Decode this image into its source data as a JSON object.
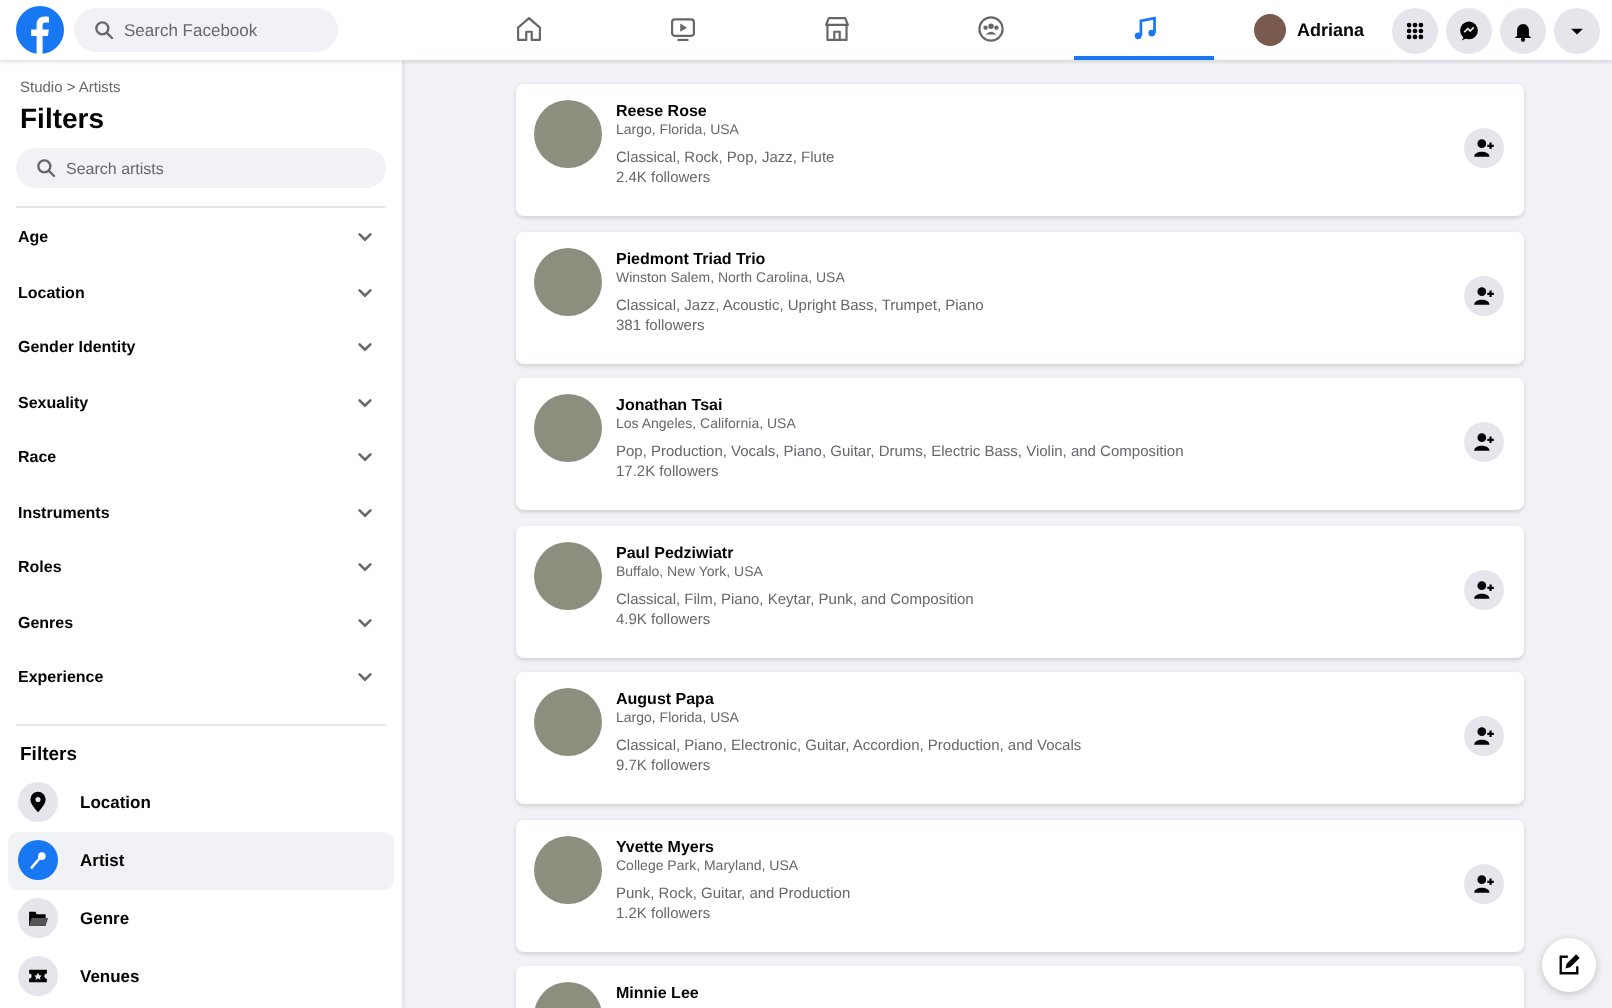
{
  "topbar": {
    "search": {
      "placeholder": "Search Facebook"
    },
    "nav": [
      {
        "kind": "home",
        "selected": false
      },
      {
        "kind": "video",
        "selected": false
      },
      {
        "kind": "store",
        "selected": false
      },
      {
        "kind": "groups",
        "selected": false
      },
      {
        "kind": "music",
        "selected": true
      }
    ],
    "profile": {
      "name": "Adriana"
    },
    "actions": [
      {
        "kind": "grid"
      },
      {
        "kind": "messenger"
      },
      {
        "kind": "bell"
      },
      {
        "kind": "caret"
      }
    ]
  },
  "sidebar": {
    "breadcrumb": "Studio > Artists",
    "title": "Filters",
    "search": {
      "placeholder": "Search artists"
    },
    "accordions": [
      {
        "label": "Age",
        "expanded": false
      },
      {
        "label": "Location",
        "expanded": false
      },
      {
        "label": "Gender Identity",
        "expanded": false
      },
      {
        "label": "Sexuality",
        "expanded": false
      },
      {
        "label": "Race",
        "expanded": false
      },
      {
        "label": "Instruments",
        "expanded": false
      },
      {
        "label": "Roles",
        "expanded": false
      },
      {
        "label": "Genres",
        "expanded": false
      },
      {
        "label": "Experience",
        "expanded": false
      }
    ],
    "filters_heading": "Filters",
    "filters": [
      {
        "label": "Location",
        "kind": "pin",
        "selected": false
      },
      {
        "label": "Artist",
        "kind": "mic",
        "selected": true
      },
      {
        "label": "Genre",
        "kind": "folder",
        "selected": false
      },
      {
        "label": "Venues",
        "kind": "ticket",
        "selected": false
      }
    ]
  },
  "artists": [
    {
      "name": "Reese Rose",
      "location": "Largo, Florida, USA",
      "tags": "Classical, Rock, Pop, Jazz, Flute",
      "followers": "2.4K followers"
    },
    {
      "name": "Piedmont Triad Trio",
      "location": "Winston Salem, North Carolina, USA",
      "tags": "Classical, Jazz, Acoustic, Upright Bass, Trumpet, Piano",
      "followers": "381 followers"
    },
    {
      "name": "Jonathan Tsai",
      "location": "Los Angeles, California, USA",
      "tags": "Pop, Production, Vocals, Piano, Guitar, Drums, Electric Bass, Violin, and Composition",
      "followers": "17.2K followers"
    },
    {
      "name": "Paul Pedziwiatr",
      "location": "Buffalo, New York, USA",
      "tags": "Classical, Film, Piano, Keytar, Punk, and Composition",
      "followers": "4.9K followers"
    },
    {
      "name": "August Papa",
      "location": "Largo, Florida, USA",
      "tags": "Classical, Piano, Electronic, Guitar, Accordion, Production, and Vocals",
      "followers": "9.7K followers"
    },
    {
      "name": "Yvette Myers",
      "location": "College Park, Maryland, USA",
      "tags": "Punk, Rock, Guitar, and Production",
      "followers": "1.2K followers"
    },
    {
      "name": "Minnie Lee"
    }
  ]
}
